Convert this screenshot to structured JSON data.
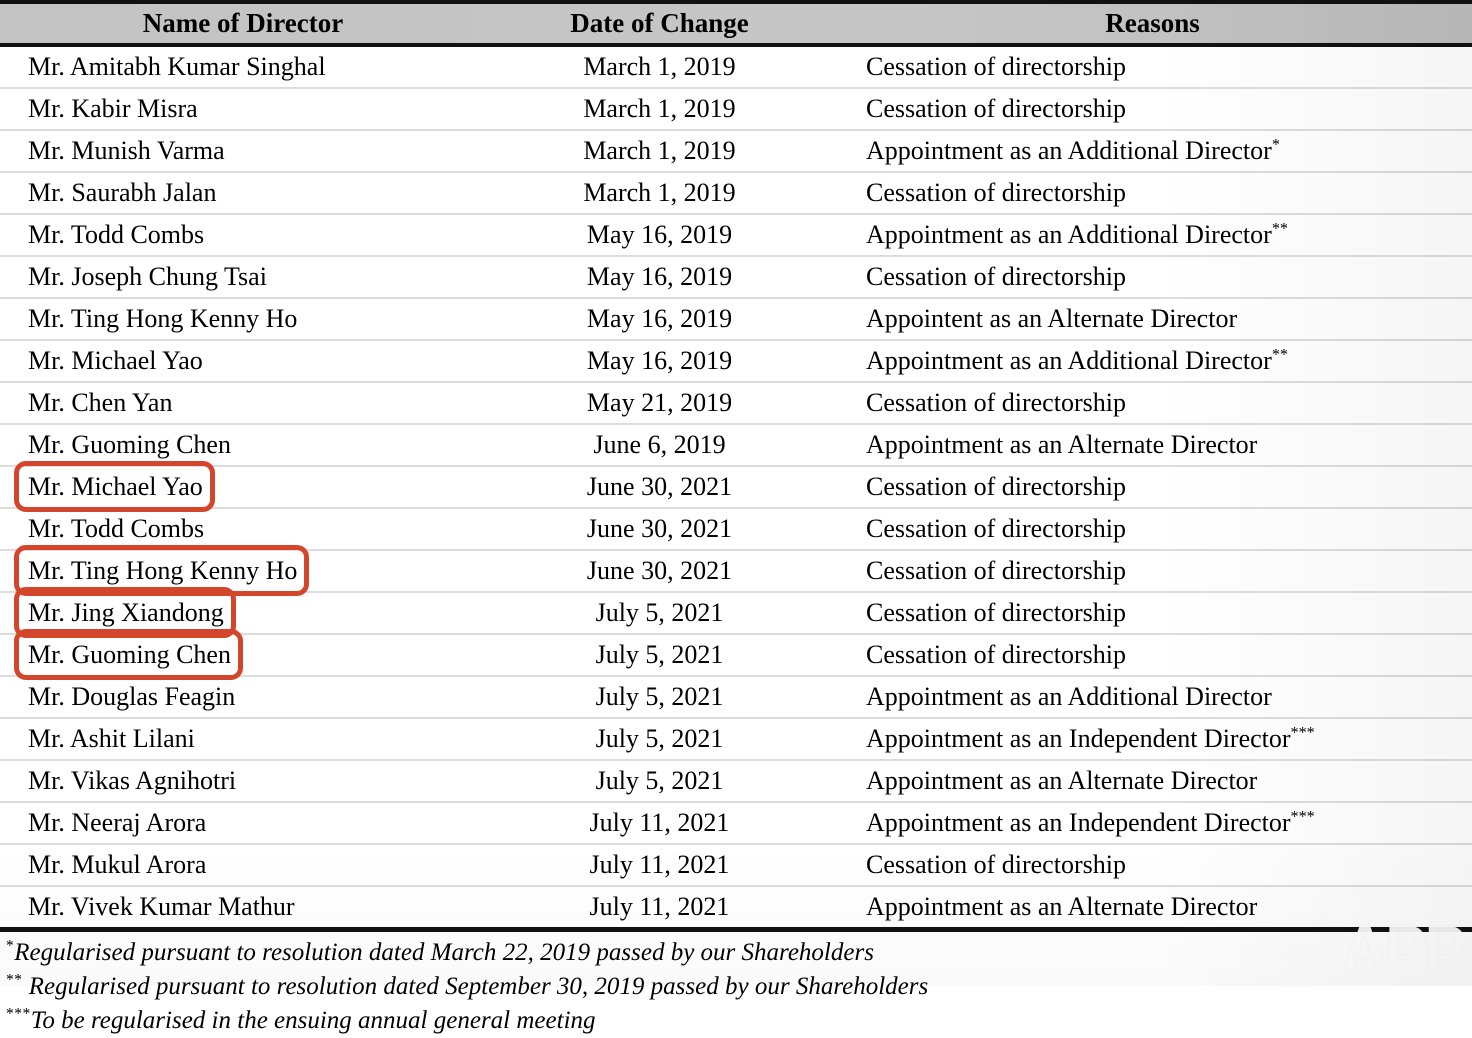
{
  "table": {
    "columns": [
      {
        "key": "name",
        "label": "Name of Director"
      },
      {
        "key": "date",
        "label": "Date of Change"
      },
      {
        "key": "reason",
        "label": "Reasons"
      }
    ],
    "rows": [
      {
        "name": "Mr. Amitabh Kumar Singhal",
        "date": "March 1, 2019",
        "reason": "Cessation of directorship",
        "footnote": "",
        "marked": false
      },
      {
        "name": "Mr. Kabir Misra",
        "date": "March 1, 2019",
        "reason": "Cessation of directorship",
        "footnote": "",
        "marked": false
      },
      {
        "name": "Mr. Munish Varma",
        "date": "March 1, 2019",
        "reason": "Appointment as an Additional Director",
        "footnote": "*",
        "marked": false
      },
      {
        "name": "Mr. Saurabh Jalan",
        "date": "March 1, 2019",
        "reason": "Cessation of directorship",
        "footnote": "",
        "marked": false
      },
      {
        "name": "Mr. Todd Combs",
        "date": "May 16, 2019",
        "reason": "Appointment as an Additional Director",
        "footnote": "**",
        "marked": false
      },
      {
        "name": "Mr. Joseph Chung Tsai",
        "date": "May 16, 2019",
        "reason": "Cessation of directorship",
        "footnote": "",
        "marked": false
      },
      {
        "name": "Mr. Ting Hong Kenny Ho",
        "date": "May 16, 2019",
        "reason": "Appointent as an Alternate Director",
        "footnote": "",
        "marked": false
      },
      {
        "name": "Mr. Michael Yao",
        "date": "May 16, 2019",
        "reason": "Appointment as an Additional Director",
        "footnote": "**",
        "marked": false
      },
      {
        "name": "Mr. Chen Yan",
        "date": "May 21, 2019",
        "reason": "Cessation of directorship",
        "footnote": "",
        "marked": false
      },
      {
        "name": "Mr. Guoming Chen",
        "date": "June 6, 2019",
        "reason": "Appointment as an Alternate Director",
        "footnote": "",
        "marked": false
      },
      {
        "name": "Mr. Michael Yao",
        "date": "June 30, 2021",
        "reason": "Cessation of directorship",
        "footnote": "",
        "marked": true
      },
      {
        "name": "Mr. Todd Combs",
        "date": "June 30, 2021",
        "reason": "Cessation of directorship",
        "footnote": "",
        "marked": false
      },
      {
        "name": "Mr. Ting Hong Kenny Ho",
        "date": "June 30, 2021",
        "reason": "Cessation of directorship",
        "footnote": "",
        "marked": true
      },
      {
        "name": "Mr. Jing Xiandong",
        "date": "July 5, 2021",
        "reason": "Cessation of directorship",
        "footnote": "",
        "marked": true
      },
      {
        "name": "Mr. Guoming Chen",
        "date": "July 5, 2021",
        "reason": "Cessation of directorship",
        "footnote": "",
        "marked": true
      },
      {
        "name": "Mr. Douglas Feagin",
        "date": "July 5, 2021",
        "reason": "Appointment as an Additional Director",
        "footnote": "",
        "marked": false
      },
      {
        "name": "Mr. Ashit Lilani",
        "date": "July 5, 2021",
        "reason": "Appointment as an Independent Director",
        "footnote": "***",
        "marked": false
      },
      {
        "name": "Mr. Vikas Agnihotri",
        "date": "July 5, 2021",
        "reason": "Appointment as an Alternate Director",
        "footnote": "",
        "marked": false
      },
      {
        "name": "Mr. Neeraj Arora",
        "date": "July 11, 2021",
        "reason": "Appointment as an Independent Director",
        "footnote": "***",
        "marked": false
      },
      {
        "name": "Mr. Mukul Arora",
        "date": "July 11, 2021",
        "reason": "Cessation of directorship",
        "footnote": "",
        "marked": false
      },
      {
        "name": "Mr. Vivek Kumar Mathur",
        "date": "July 11, 2021",
        "reason": "Appointment as an Alternate Director",
        "footnote": "",
        "marked": false
      }
    ]
  },
  "footnotes": [
    {
      "mark": "*",
      "text": "Regularised pursuant to resolution dated March 22, 2019 passed by our Shareholders"
    },
    {
      "mark": "**",
      "text": " Regularised pursuant to resolution dated September 30, 2019 passed by our Shareholders"
    },
    {
      "mark": "***",
      "text": "To be regularised in the ensuing annual general meeting"
    }
  ],
  "watermark": {
    "text": "APP"
  },
  "colors": {
    "header_background": "#c3c3c3",
    "rule": "#111111",
    "row_separator": "#dcdcdc",
    "annotation_box": "#d4462c",
    "text": "#000000"
  }
}
